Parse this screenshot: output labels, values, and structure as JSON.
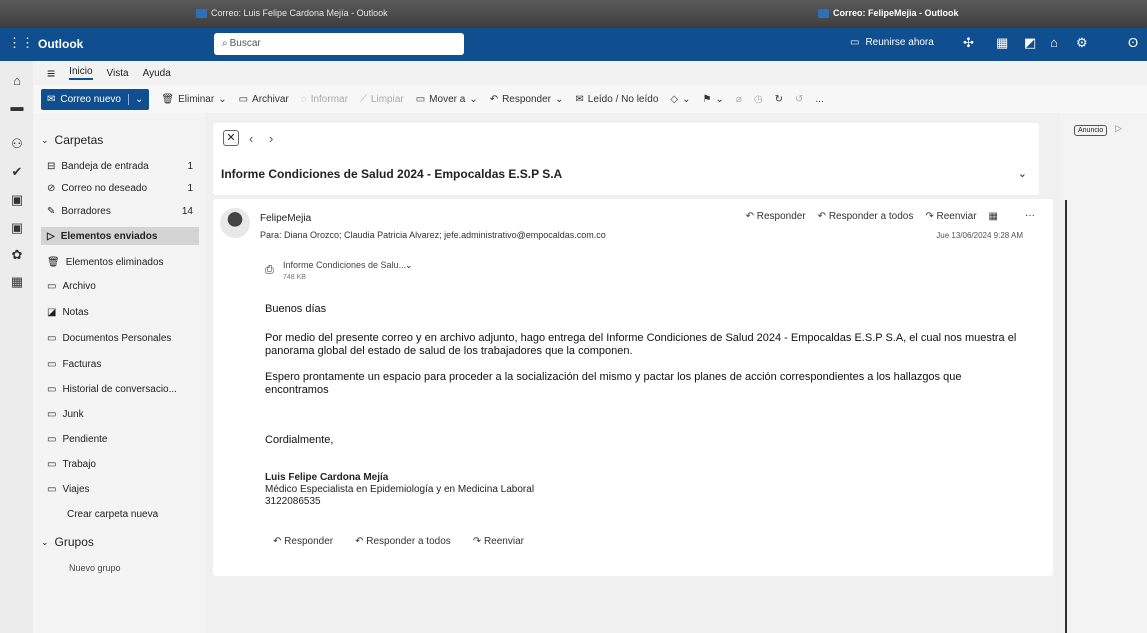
{
  "window": {
    "tab_left": "Correo: Luis Felipe Cardona Mejía - Outlook",
    "tab_right": "Correo: FelipeMejia - Outlook"
  },
  "header": {
    "app_name": "Outlook",
    "search_placeholder": "Buscar",
    "meet_now": "Reunirse ahora"
  },
  "ribbon": {
    "tabs": [
      "Inicio",
      "Vista",
      "Ayuda"
    ],
    "new_mail": "Correo nuevo",
    "delete": "Eliminar",
    "archive": "Archivar",
    "report": "Informar",
    "sweep": "Limpiar",
    "move_to": "Mover a",
    "reply": "Responder",
    "read_unread": "Leído / No leído",
    "more": "..."
  },
  "sidebar": {
    "folders_title": "Carpetas",
    "folders": [
      {
        "label": "Bandeja de entrada",
        "count": "1",
        "icon": "inbox-icon"
      },
      {
        "label": "Correo no deseado",
        "count": "1",
        "icon": "junk-icon"
      },
      {
        "label": "Borradores",
        "count": "14",
        "icon": "drafts-icon"
      },
      {
        "label": "Elementos enviados",
        "count": "",
        "icon": "sent-icon"
      },
      {
        "label": "Elementos eliminados",
        "count": "",
        "icon": "trash-icon"
      },
      {
        "label": "Archivo",
        "count": "",
        "icon": "archive-icon"
      },
      {
        "label": "Notas",
        "count": "",
        "icon": "notes-icon"
      },
      {
        "label": "Documentos Personales",
        "count": "",
        "icon": "folder-icon"
      },
      {
        "label": "Facturas",
        "count": "",
        "icon": "folder-icon"
      },
      {
        "label": "Historial de conversacio...",
        "count": "",
        "icon": "folder-icon"
      },
      {
        "label": "Junk",
        "count": "",
        "icon": "folder-icon"
      },
      {
        "label": "Pendiente",
        "count": "",
        "icon": "folder-icon"
      },
      {
        "label": "Trabajo",
        "count": "",
        "icon": "folder-icon"
      },
      {
        "label": "Viajes",
        "count": "",
        "icon": "folder-icon"
      }
    ],
    "selected_folder": "Elementos enviados",
    "create_folder": "Crear carpeta nueva",
    "groups_title": "Grupos",
    "new_group": "Nuevo grupo"
  },
  "message": {
    "subject": "Informe Condiciones de Salud 2024 - Empocaldas E.S.P S.A",
    "sender": "FelipeMejia",
    "to_label": "Para:",
    "recipients": "Diana Orozco;  Claudia Patricia Alvarez;  jefe.administrativo@empocaldas.com.co",
    "date": "Jue 13/06/2024 9:28 AM",
    "actions": {
      "reply": "Responder",
      "reply_all": "Responder a todos",
      "forward": "Reenviar"
    },
    "attachment": {
      "name": "Informe Condiciones de Salu...",
      "size": "748 KB"
    },
    "greeting": "Buenos días",
    "paragraph1": "Por medio del presente correo y en archivo adjunto, hago entrega del Informe Condiciones de Salud 2024 - Empocaldas E.S.P S.A, el cual nos muestra el panorama global del estado de salud de los trabajadores que la componen.",
    "paragraph2": "Espero prontamente un espacio para proceder a la socialización del mismo y pactar los planes de acción correspondientes a los hallazgos que encontramos",
    "closing": "Cordialmente,",
    "signature_name": "Luis Felipe Cardona Mejía",
    "signature_title": "Médico Especialista en Epidemiología y en Medicina Laboral",
    "signature_phone": "3122086535"
  },
  "ad": {
    "badge": "Anuncio"
  }
}
